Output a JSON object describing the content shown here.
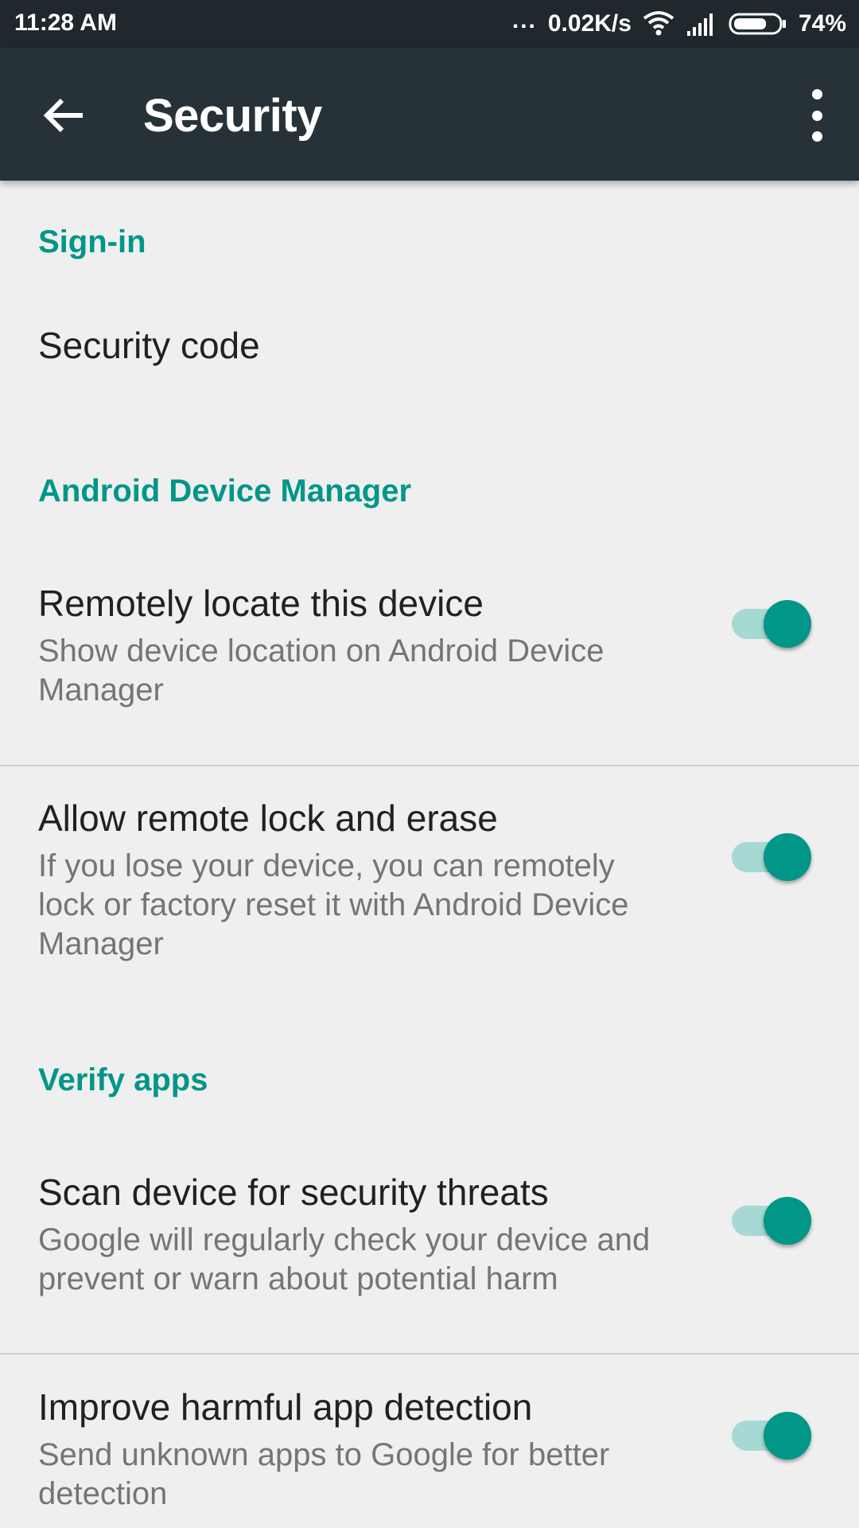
{
  "status_bar": {
    "time": "11:28 AM",
    "dots": "...",
    "network_speed": "0.02K/s",
    "battery_percent": "74%",
    "battery_level": 0.74
  },
  "app_bar": {
    "title": "Security",
    "back_icon": "arrow-back-icon",
    "menu_icon": "more-vert-icon"
  },
  "sections": {
    "signin": {
      "header": "Sign-in",
      "security_code": {
        "title": "Security code"
      }
    },
    "adm": {
      "header": "Android Device Manager",
      "remote_locate": {
        "title": "Remotely locate this device",
        "summary": "Show device location on Android Device Manager",
        "enabled": true
      },
      "remote_lock": {
        "title": "Allow remote lock and erase",
        "summary": "If you lose your device, you can remotely lock or factory reset it with Android Device Manager",
        "enabled": true
      }
    },
    "verify": {
      "header": "Verify apps",
      "scan": {
        "title": "Scan device for security threats",
        "summary": "Google will regularly check your device and prevent or warn about potential harm",
        "enabled": true
      },
      "improve": {
        "title": "Improve harmful app detection",
        "summary": "Send unknown apps to Google for better detection",
        "enabled": true
      }
    }
  },
  "colors": {
    "accent": "#009688",
    "accent_track": "#a7d9d4",
    "app_bar": "#263238",
    "status_bar": "#1f282d",
    "background": "#efefef"
  }
}
